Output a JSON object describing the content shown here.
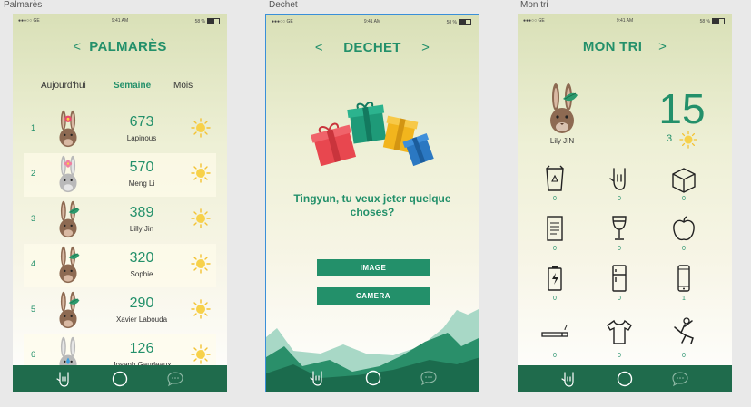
{
  "artboards": {
    "palmares": "Palmarès",
    "dechet": "Dechet",
    "montri": "Mon tri"
  },
  "status": {
    "carrier": "●●●○○ GE",
    "time": "9:41 AM",
    "battery": "58 %"
  },
  "palmares": {
    "title": "PALMARÈS",
    "prev": "<",
    "periods": [
      "Aujourd'hui",
      "Semaine",
      "Mois"
    ],
    "active_period": "Semaine",
    "rows": [
      {
        "rank": "1",
        "score": "673",
        "name": "Lapinous",
        "leaf": "pink"
      },
      {
        "rank": "2",
        "score": "570",
        "name": "Meng Li",
        "leaf": "pinkflower"
      },
      {
        "rank": "3",
        "score": "389",
        "name": "Lilly Jin",
        "leaf": "green"
      },
      {
        "rank": "4",
        "score": "320",
        "name": "Sophie",
        "leaf": "green"
      },
      {
        "rank": "5",
        "score": "290",
        "name": "Xavier Labouda",
        "leaf": "green"
      },
      {
        "rank": "6",
        "score": "126",
        "name": "Joseph Gaudeaux",
        "leaf": "drop"
      }
    ]
  },
  "dechet": {
    "title": "DECHET",
    "prev": "<",
    "next": ">",
    "question": "Tingyun, tu veux jeter quelque choses?",
    "btn_image": "IMAGE",
    "btn_camera": "CAMERA"
  },
  "montri": {
    "title": "MON TRI",
    "next": ">",
    "user": "Lily JIN",
    "big_score": "15",
    "suns": "3",
    "items": [
      {
        "icon": "recycle-bag-icon",
        "count": "0"
      },
      {
        "icon": "rock-hand-icon",
        "count": "0"
      },
      {
        "icon": "box-icon",
        "count": "0"
      },
      {
        "icon": "paper-icon",
        "count": "0"
      },
      {
        "icon": "wine-glass-icon",
        "count": "0"
      },
      {
        "icon": "apple-icon",
        "count": "0"
      },
      {
        "icon": "battery-icon",
        "count": "0"
      },
      {
        "icon": "fridge-icon",
        "count": "0"
      },
      {
        "icon": "phone-icon",
        "count": "1"
      },
      {
        "icon": "cigarette-icon",
        "count": "0"
      },
      {
        "icon": "tshirt-icon",
        "count": "0"
      },
      {
        "icon": "jumping-person-icon",
        "count": "0"
      }
    ]
  },
  "colors": {
    "accent": "#23906a",
    "tabbar": "#1f6b4c"
  }
}
